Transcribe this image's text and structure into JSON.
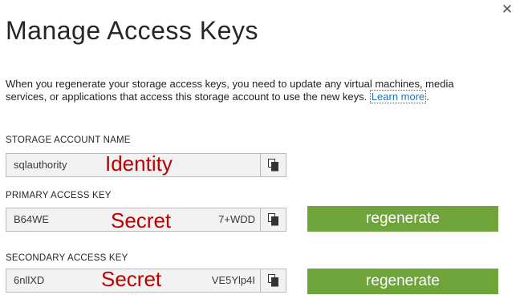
{
  "dialog": {
    "close_glyph": "✕",
    "title": "Manage Access Keys",
    "description": "When you regenerate your storage access keys, you need to update any virtual machines, media services, or applications that access this storage account to use the new keys.",
    "learn_more": "Learn more",
    "period": "."
  },
  "storage_account": {
    "label": "STORAGE ACCOUNT NAME",
    "value": "sqlauthority",
    "overlay": "Identity"
  },
  "primary": {
    "label": "PRIMARY ACCESS KEY",
    "value_start": "B64WE",
    "value_end": "7+WDD",
    "overlay": "Secret",
    "button": "regenerate"
  },
  "secondary": {
    "label": "SECONDARY ACCESS KEY",
    "value_start": "6nllXD",
    "value_end": "VE5Ylp4I",
    "overlay": "Secret",
    "button": "regenerate"
  },
  "colors": {
    "accent_green": "#6ea43a",
    "redaction_red": "#c00000",
    "link_blue": "#1e74b9"
  },
  "icons": {
    "close": "close-icon",
    "copy": "copy-icon"
  }
}
